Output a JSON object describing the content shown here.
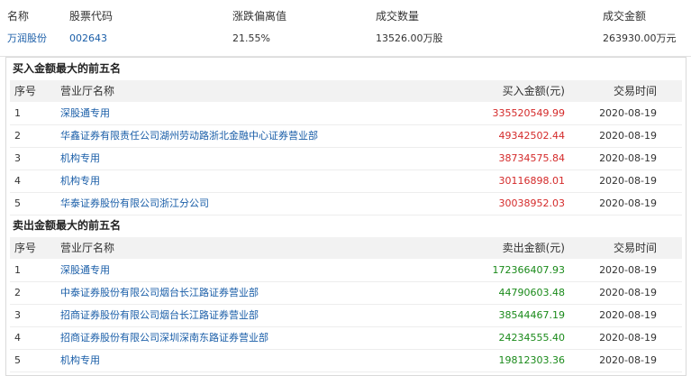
{
  "summary": {
    "headers": [
      "名称",
      "股票代码",
      "涨跌偏离值",
      "成交数量",
      "成交金额"
    ],
    "name": "万润股份",
    "code": "002643",
    "deviation": "21.55%",
    "volume": "13526.00万股",
    "amount": "263930.00万元"
  },
  "buy": {
    "title": "买入金额最大的前五名",
    "headers": [
      "序号",
      "营业厅名称",
      "买入金额(元)",
      "交易时间"
    ],
    "rows": [
      {
        "no": "1",
        "name": "深股通专用",
        "amount": "335520549.99",
        "date": "2020-08-19"
      },
      {
        "no": "2",
        "name": "华鑫证券有限责任公司湖州劳动路浙北金融中心证券营业部",
        "amount": "49342502.44",
        "date": "2020-08-19"
      },
      {
        "no": "3",
        "name": "机构专用",
        "amount": "38734575.84",
        "date": "2020-08-19"
      },
      {
        "no": "4",
        "name": "机构专用",
        "amount": "30116898.01",
        "date": "2020-08-19"
      },
      {
        "no": "5",
        "name": "华泰证券股份有限公司浙江分公司",
        "amount": "30038952.03",
        "date": "2020-08-19"
      }
    ]
  },
  "sell": {
    "title": "卖出金额最大的前五名",
    "headers": [
      "序号",
      "营业厅名称",
      "卖出金额(元)",
      "交易时间"
    ],
    "rows": [
      {
        "no": "1",
        "name": "深股通专用",
        "amount": "172366407.93",
        "date": "2020-08-19"
      },
      {
        "no": "2",
        "name": "中泰证券股份有限公司烟台长江路证券营业部",
        "amount": "44790603.48",
        "date": "2020-08-19"
      },
      {
        "no": "3",
        "name": "招商证券股份有限公司烟台长江路证券营业部",
        "amount": "38544467.19",
        "date": "2020-08-19"
      },
      {
        "no": "4",
        "name": "招商证券股份有限公司深圳深南东路证券营业部",
        "amount": "24234555.40",
        "date": "2020-08-19"
      },
      {
        "no": "5",
        "name": "机构专用",
        "amount": "19812303.36",
        "date": "2020-08-19"
      }
    ]
  },
  "colors": {
    "link": "#1a5ea8",
    "buy": "#d42a2a",
    "sell": "#1a8a1a",
    "header_bg": "#f2f2f2"
  }
}
